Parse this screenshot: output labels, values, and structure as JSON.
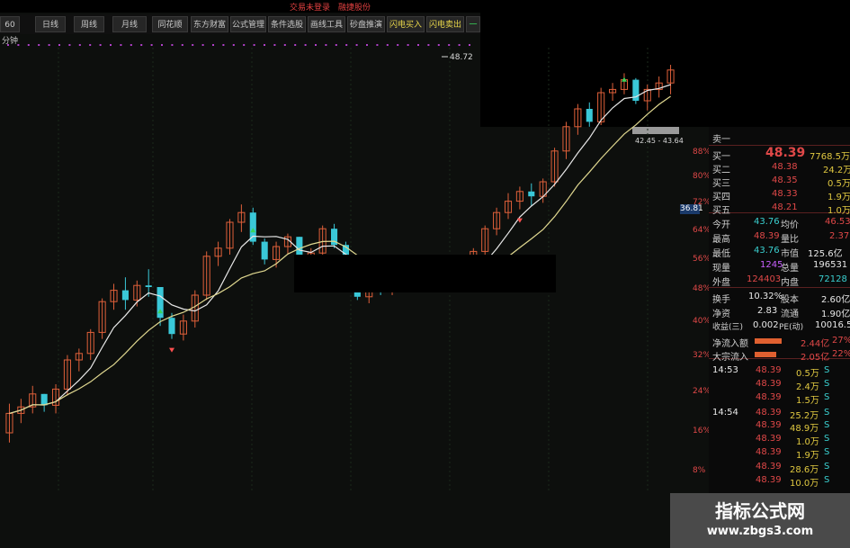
{
  "top_status": {
    "left": "交易未登录",
    "right": "融捷股份"
  },
  "toolbar": {
    "buttons": [
      {
        "label": "60分钟",
        "state": "normal"
      },
      {
        "label": "日线",
        "state": "normal"
      },
      {
        "label": "周线",
        "state": "normal"
      },
      {
        "label": "月线",
        "state": "normal"
      },
      {
        "label": "同花顺",
        "state": "normal"
      },
      {
        "label": "东方财富",
        "state": "normal"
      },
      {
        "label": "公式管理",
        "state": "normal"
      },
      {
        "label": "条件选股",
        "state": "normal"
      },
      {
        "label": "画线工具",
        "state": "normal"
      },
      {
        "label": "砂盘推演",
        "state": "normal"
      },
      {
        "label": "闪电买入",
        "state": "active"
      },
      {
        "label": "闪电卖出",
        "state": "active"
      },
      {
        "label": "一",
        "state": "green"
      }
    ]
  },
  "chart": {
    "peak_label": "48.72",
    "range_label": "42.45 - 43.64",
    "price_tag": "36.81",
    "pct_ticks": [
      "88%",
      "80%",
      "72%",
      "64%",
      "56%",
      "48%",
      "40%",
      "32%",
      "24%",
      "16%",
      "8%"
    ],
    "colors": {
      "up": "#e0603a",
      "down": "#3ac8d8",
      "ma_fast": "#e8e8e8",
      "ma_slow": "#e0d890",
      "buy_marker": "#3ad45a",
      "sell_marker": "#ff5050"
    }
  },
  "chart_data": {
    "type": "candlestick",
    "ohlc": [
      [
        26.0,
        27.8,
        25.4,
        27.2
      ],
      [
        27.2,
        28.1,
        26.6,
        27.6
      ],
      [
        27.6,
        28.9,
        27.2,
        28.4
      ],
      [
        28.4,
        28.4,
        27.3,
        27.7
      ],
      [
        27.7,
        29.0,
        27.2,
        28.7
      ],
      [
        28.7,
        30.8,
        28.3,
        30.5
      ],
      [
        30.5,
        31.2,
        29.8,
        30.9
      ],
      [
        30.9,
        32.4,
        30.5,
        32.2
      ],
      [
        32.2,
        34.3,
        31.8,
        34.1
      ],
      [
        34.1,
        35.2,
        33.6,
        34.8
      ],
      [
        34.8,
        35.6,
        33.6,
        34.2
      ],
      [
        34.2,
        35.4,
        33.8,
        35.1
      ],
      [
        35.1,
        36.1,
        34.4,
        35.0
      ],
      [
        35.0,
        35.0,
        32.6,
        33.1
      ],
      [
        33.1,
        33.4,
        31.8,
        32.1
      ],
      [
        32.1,
        33.3,
        31.7,
        32.9
      ],
      [
        32.9,
        34.8,
        32.5,
        34.5
      ],
      [
        34.5,
        37.2,
        34.2,
        36.9
      ],
      [
        36.9,
        37.8,
        36.3,
        37.4
      ],
      [
        37.4,
        39.2,
        37.0,
        39.0
      ],
      [
        39.0,
        40.1,
        38.4,
        39.6
      ],
      [
        39.6,
        39.9,
        37.6,
        37.8
      ],
      [
        37.8,
        38.0,
        36.4,
        36.7
      ],
      [
        36.7,
        37.8,
        36.2,
        37.5
      ],
      [
        37.5,
        38.3,
        37.0,
        38.1
      ],
      [
        38.1,
        38.1,
        36.0,
        36.3
      ],
      [
        36.3,
        37.4,
        35.8,
        37.1
      ],
      [
        37.1,
        38.8,
        36.8,
        38.6
      ],
      [
        38.6,
        38.9,
        37.4,
        37.6
      ],
      [
        37.6,
        37.8,
        35.3,
        35.5
      ],
      [
        35.5,
        36.0,
        34.2,
        34.4
      ],
      [
        34.4,
        35.8,
        34.0,
        35.4
      ],
      [
        35.4,
        35.5,
        34.5,
        34.8
      ],
      [
        34.8,
        35.9,
        34.5,
        35.6
      ],
      [
        35.6,
        36.1,
        35.0,
        35.3
      ],
      [
        35.3,
        35.5,
        34.8,
        35.2
      ],
      [
        35.2,
        36.0,
        34.9,
        35.8
      ],
      [
        35.8,
        35.9,
        35.2,
        35.4
      ],
      [
        35.4,
        35.8,
        35.0,
        35.5
      ],
      [
        35.5,
        36.2,
        35.2,
        35.9
      ],
      [
        35.9,
        37.4,
        35.6,
        37.2
      ],
      [
        37.2,
        38.8,
        37.0,
        38.6
      ],
      [
        38.6,
        39.9,
        38.2,
        39.6
      ],
      [
        39.6,
        40.8,
        39.2,
        40.3
      ],
      [
        40.3,
        41.2,
        39.8,
        40.9
      ],
      [
        40.9,
        41.4,
        40.0,
        40.6
      ],
      [
        40.6,
        41.7,
        40.2,
        41.5
      ],
      [
        41.5,
        43.6,
        41.2,
        43.4
      ],
      [
        43.4,
        45.2,
        42.9,
        44.9
      ],
      [
        44.9,
        46.3,
        44.4,
        46.0
      ],
      [
        46.0,
        46.4,
        44.9,
        45.2
      ],
      [
        45.2,
        47.3,
        45.0,
        47.0
      ],
      [
        47.0,
        47.6,
        46.5,
        47.2
      ],
      [
        47.2,
        48.2,
        46.9,
        47.8
      ],
      [
        47.8,
        47.9,
        46.3,
        46.5
      ],
      [
        46.5,
        47.5,
        45.9,
        47.2
      ],
      [
        47.2,
        48.0,
        46.7,
        47.6
      ],
      [
        47.6,
        48.72,
        46.9,
        48.4
      ]
    ]
  },
  "quotes": {
    "sell1_label": "卖一",
    "buy_book": [
      {
        "label": "买一",
        "price": "48.39",
        "vol": "7768.5万"
      },
      {
        "label": "买二",
        "price": "48.38",
        "vol": "24.2万"
      },
      {
        "label": "买三",
        "price": "48.35",
        "vol": "0.5万"
      },
      {
        "label": "买四",
        "price": "48.33",
        "vol": "1.9万"
      },
      {
        "label": "买五",
        "price": "48.21",
        "vol": "1.0万"
      }
    ],
    "stats_left": [
      {
        "label": "今开",
        "value": "43.76",
        "color": "cyan"
      },
      {
        "label": "最高",
        "value": "48.39",
        "color": "red"
      },
      {
        "label": "最低",
        "value": "43.76",
        "color": "cyan"
      },
      {
        "label": "现量",
        "value": "1245",
        "color": "pur"
      },
      {
        "label": "外盘",
        "value": "124403",
        "color": "red"
      }
    ],
    "stats_right": [
      {
        "label": "均价",
        "value": "46.53",
        "color": "red"
      },
      {
        "label": "量比",
        "value": "2.37",
        "color": "red"
      },
      {
        "label": "市值",
        "value": "125.6亿",
        "color": "wht"
      },
      {
        "label": "总量",
        "value": "196531",
        "color": "wht"
      },
      {
        "label": "内盘",
        "value": "72128",
        "color": "cyan"
      }
    ],
    "stats2_left": [
      {
        "label": "换手",
        "value": "10.32%"
      },
      {
        "label": "净资",
        "value": "2.83"
      },
      {
        "label": "收益(三)",
        "value": "0.002"
      }
    ],
    "stats2_right": [
      {
        "label": "股本",
        "value": "2.60亿"
      },
      {
        "label": "流通",
        "value": "1.90亿"
      },
      {
        "label": "PE(动)",
        "value": "10016.5"
      }
    ],
    "flows": [
      {
        "label": "净流入额",
        "value": "2.44亿",
        "pct": "27%"
      },
      {
        "label": "大宗流入",
        "value": "2.05亿",
        "pct": "22%"
      }
    ],
    "ticks": [
      {
        "time": "14:53",
        "price": "48.39",
        "vol": "0.5万",
        "side": "S"
      },
      {
        "time": "",
        "price": "48.39",
        "vol": "2.4万",
        "side": "S"
      },
      {
        "time": "",
        "price": "48.39",
        "vol": "1.5万",
        "side": "S"
      },
      {
        "time": "14:54",
        "price": "48.39",
        "vol": "25.2万",
        "side": "S"
      },
      {
        "time": "",
        "price": "48.39",
        "vol": "48.9万",
        "side": "S"
      },
      {
        "time": "",
        "price": "48.39",
        "vol": "1.0万",
        "side": "S"
      },
      {
        "time": "",
        "price": "48.39",
        "vol": "1.9万",
        "side": "S"
      },
      {
        "time": "",
        "price": "48.39",
        "vol": "28.6万",
        "side": "S"
      },
      {
        "time": "",
        "price": "48.39",
        "vol": "10.0万",
        "side": "S"
      }
    ]
  },
  "watermark": {
    "title": "指标公式网",
    "url": "www.zbgs3.com"
  }
}
